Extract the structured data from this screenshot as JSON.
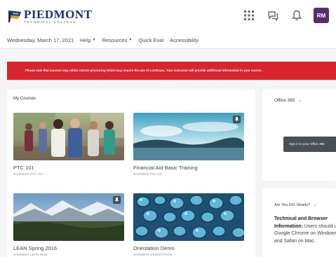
{
  "header": {
    "logo": {
      "name": "PIEDMONT",
      "subtitle": "TECHNICAL COLLEGE"
    },
    "icons": [
      "grid-icon",
      "chat-icon",
      "bell-icon"
    ],
    "avatar_initials": "RM"
  },
  "nav": {
    "items": [
      {
        "label": "Wednesday, March 17, 2021",
        "has_menu": false
      },
      {
        "label": "Help",
        "has_menu": true
      },
      {
        "label": "Resources",
        "has_menu": true
      },
      {
        "label": "Quick Eval",
        "has_menu": false
      },
      {
        "label": "Accessibility",
        "has_menu": false
      }
    ]
  },
  "alert": {
    "text": "Please note that courses may utilize remote proctoring which may require the use of a webcam. Your instructor will provide additional information in your course."
  },
  "my_courses": {
    "title": "My Courses",
    "courses": [
      {
        "name": "PTC 101",
        "code": "SANDBOX PTC 101"
      },
      {
        "name": "Financial Aid Basic Training",
        "code": "SANDBOX FIN AID"
      },
      {
        "name": "LEAN Spring 2016",
        "code": "SANDBOX LEAN 2016"
      },
      {
        "name": "Orientation Demo",
        "code": "SANDBOX ORIENTATION"
      }
    ]
  },
  "office365": {
    "title": "Office 365",
    "signin_label": "Sign in to your Office 365"
  },
  "d2l_ready": {
    "title": "Are You D2L Ready?",
    "heading": "Technical and Browser Information:",
    "body": "Users should use Google Chrome on Windows PCs and Safari on Mac."
  },
  "colors": {
    "brand_navy": "#1c2f6b",
    "alert_red": "#d9242b",
    "avatar_purple": "#5b2b6b",
    "signin_gray": "#4b4f54"
  }
}
